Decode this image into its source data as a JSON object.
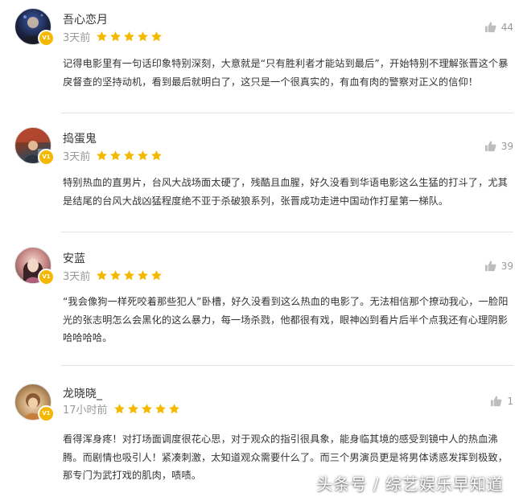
{
  "colors": {
    "star": "#f5b800",
    "badge": "#f5b800",
    "meta_text": "#999999",
    "body_text": "#333333",
    "divider": "#e3e3e3"
  },
  "comments": [
    {
      "username": "吾心恋月",
      "badge": "V1",
      "time": "3天前",
      "rating": 5,
      "likes": "44",
      "text": "记得电影里有一句话印象特别深刻，大意就是“只有胜利者才能站到最后”，开始特别不理解张晋这个暴戾督查的坚持动机，看到最后就明白了，这只是一个很真实的，有血有肉的警察对正义的信仰！"
    },
    {
      "username": "捣蛋鬼",
      "badge": "V1",
      "time": "3天前",
      "rating": 5,
      "likes": "39",
      "text": "特别热血的直男片，台风大战场面太硬了，残酷且血腥，好久没看到华语电影这么生猛的打斗了，尤其是结尾的台风大战凶猛程度绝不亚于杀破狼系列，张晋成功走进中国动作打星第一梯队。"
    },
    {
      "username": "安蓝",
      "badge": "V1",
      "time": "3天前",
      "rating": 5,
      "likes": "39",
      "text": "“我会像狗一样死咬着那些犯人”卧槽，好久没看到这么热血的电影了。无法相信那个撩动我心，一脸阳光的张志明怎么会黑化的这么暴力，每一场杀戮，他都很有戏，眼神凶到看片后半个点我还有心理阴影哈哈哈哈。"
    },
    {
      "username": "龙晓晓_",
      "badge": "V1",
      "time": "17小时前",
      "rating": 5,
      "likes": "1",
      "text": "看得浑身疼！对打场面调度很花心思，对于观众的指引很具象，能身临其境的感受到镜中人的热血沸腾。而剧情也吸引人！紧凑刺激，太知道观众需要什么了。而三个男演员更是将男体诱惑发挥到极致，那专门为武打戏的肌肉，啧啧。"
    }
  ],
  "watermark": "头条号 / 综艺娱乐早知道"
}
